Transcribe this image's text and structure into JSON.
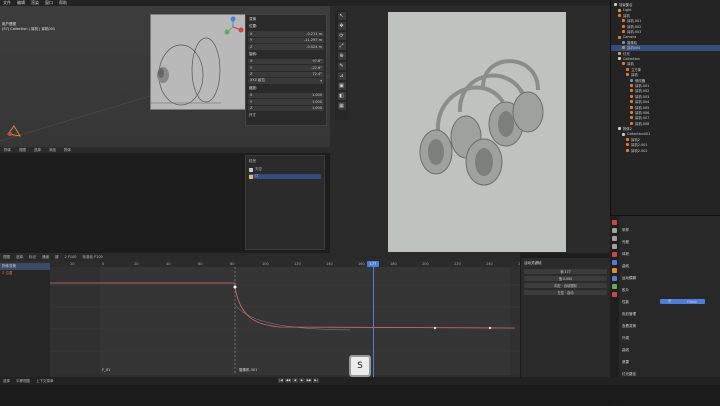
{
  "topbar": {
    "menus": [
      "文件",
      "编辑",
      "渲染",
      "窗口",
      "帮助"
    ]
  },
  "viewport": {
    "info_line1": "用户透视",
    "info_line2": "(57) Collection | 耳机 | 耳机001",
    "header_items": [
      "物体",
      "视图",
      "选择",
      "添加",
      "物体"
    ],
    "n_panel": {
      "title": "变换",
      "section_location": "位置:",
      "loc": [
        {
          "axis": "X",
          "val": "-0.211 m"
        },
        {
          "axis": "Y",
          "val": "-11.297 m"
        },
        {
          "axis": "Z",
          "val": "-0.024 m"
        }
      ],
      "section_rotation": "旋转:",
      "rot": [
        {
          "axis": "X",
          "val": "97.8°"
        },
        {
          "axis": "Y",
          "val": "-22.6°"
        },
        {
          "axis": "Z",
          "val": "72.4°"
        }
      ],
      "mode": "XYZ 欧拉",
      "section_scale": "缩放:",
      "scale": [
        {
          "axis": "X",
          "val": "1.000"
        },
        {
          "axis": "Y",
          "val": "1.000"
        },
        {
          "axis": "Z",
          "val": "1.000"
        }
      ],
      "dimensions": "尺寸"
    }
  },
  "lighting": {
    "title": "灯光",
    "item1": "天空",
    "item2": "灯"
  },
  "outliner": {
    "items": [
      {
        "label": "场景集合",
        "depth": 0,
        "color": "#cccccc",
        "sel": false
      },
      {
        "label": "Light",
        "depth": 1,
        "color": "#e0a040",
        "sel": false
      },
      {
        "label": "耳机",
        "depth": 1,
        "color": "#e07a30",
        "sel": false
      },
      {
        "label": "耳机.001",
        "depth": 2,
        "color": "#e07a30",
        "sel": false
      },
      {
        "label": "耳机.002",
        "depth": 2,
        "color": "#e07a30",
        "sel": false
      },
      {
        "label": "耳机.003",
        "depth": 2,
        "color": "#e07a30",
        "sel": false
      },
      {
        "label": "Camera",
        "depth": 1,
        "color": "#e07a30",
        "sel": false
      },
      {
        "label": "摄像机",
        "depth": 2,
        "color": "#5a9ad8",
        "sel": false
      },
      {
        "label": "耳机004",
        "depth": 2,
        "color": "#e07a30",
        "sel": true
      },
      {
        "label": "灯光",
        "depth": 1,
        "color": "#e0a040",
        "sel": false
      },
      {
        "label": "Collection",
        "depth": 1,
        "color": "#cccccc",
        "sel": false
      },
      {
        "label": "耳机",
        "depth": 2,
        "color": "#e07a30",
        "sel": false
      },
      {
        "label": "立方体",
        "depth": 3,
        "color": "#e07a30",
        "sel": false
      },
      {
        "label": "耳机",
        "depth": 3,
        "color": "#e07a30",
        "sel": false
      },
      {
        "label": "修改器",
        "depth": 4,
        "color": "#5a9ad8",
        "sel": false
      },
      {
        "label": "耳机.001",
        "depth": 4,
        "color": "#e07a30",
        "sel": false
      },
      {
        "label": "耳机.002",
        "depth": 4,
        "color": "#e07a30",
        "sel": false
      },
      {
        "label": "耳机.003",
        "depth": 4,
        "color": "#e07a30",
        "sel": false
      },
      {
        "label": "耳机.004",
        "depth": 4,
        "color": "#e07a30",
        "sel": false
      },
      {
        "label": "耳机.005",
        "depth": 4,
        "color": "#e07a30",
        "sel": false
      },
      {
        "label": "耳机.006",
        "depth": 4,
        "color": "#e07a30",
        "sel": false
      },
      {
        "label": "耳机.007",
        "depth": 4,
        "color": "#e07a30",
        "sel": false
      },
      {
        "label": "耳机.008",
        "depth": 4,
        "color": "#e07a30",
        "sel": false
      },
      {
        "label": "物体2",
        "depth": 1,
        "color": "#cccccc",
        "sel": false
      },
      {
        "label": "Collection001",
        "depth": 2,
        "color": "#cccccc",
        "sel": false
      },
      {
        "label": "耳机2",
        "depth": 3,
        "color": "#e07a30",
        "sel": false
      },
      {
        "label": "耳机2.001",
        "depth": 3,
        "color": "#e07a30",
        "sel": false
      },
      {
        "label": "耳机2.002",
        "depth": 3,
        "color": "#e07a30",
        "sel": false
      }
    ]
  },
  "properties": {
    "sections": [
      "采样",
      "光程",
      "体积",
      "曲线",
      "运动模糊",
      "胶片",
      "性能",
      "色彩管理",
      "查看变换",
      "外观",
      "曲线",
      "遮罩",
      "灯光路径",
      "烘焙"
    ],
    "look_label": "外观",
    "exposure_label": "曝光",
    "gamma_label": "伽马",
    "look_val": "无",
    "filmic_val": "Filmic"
  },
  "graph": {
    "header": [
      "视图",
      "选择",
      "标记",
      "通道",
      "键",
      "2 F100",
      "标准化 F100"
    ],
    "channels": [
      "物体变换",
      "Z 位置"
    ],
    "ruler": [
      "20",
      "0",
      "20",
      "40",
      "60",
      "80",
      "100",
      "120",
      "140",
      "160",
      "180",
      "200",
      "220",
      "240",
      "260"
    ],
    "playhead": "177",
    "marker1": "F_01",
    "marker2": "摄像机.001",
    "side_title": "活动关键帧",
    "frame_label": "帧",
    "frame_val": "177",
    "value_label": "值",
    "value_val": "0.000",
    "btn1": "向左 · 自动钳制",
    "btn2": "左控 · 自动",
    "key_badge": "S"
  },
  "statusbar": {
    "items": [
      "选择",
      "平移视图",
      "上下文菜单"
    ],
    "playback": [
      "|◀",
      "◀◀",
      "◀",
      "▶",
      "▶▶",
      "▶|"
    ]
  }
}
